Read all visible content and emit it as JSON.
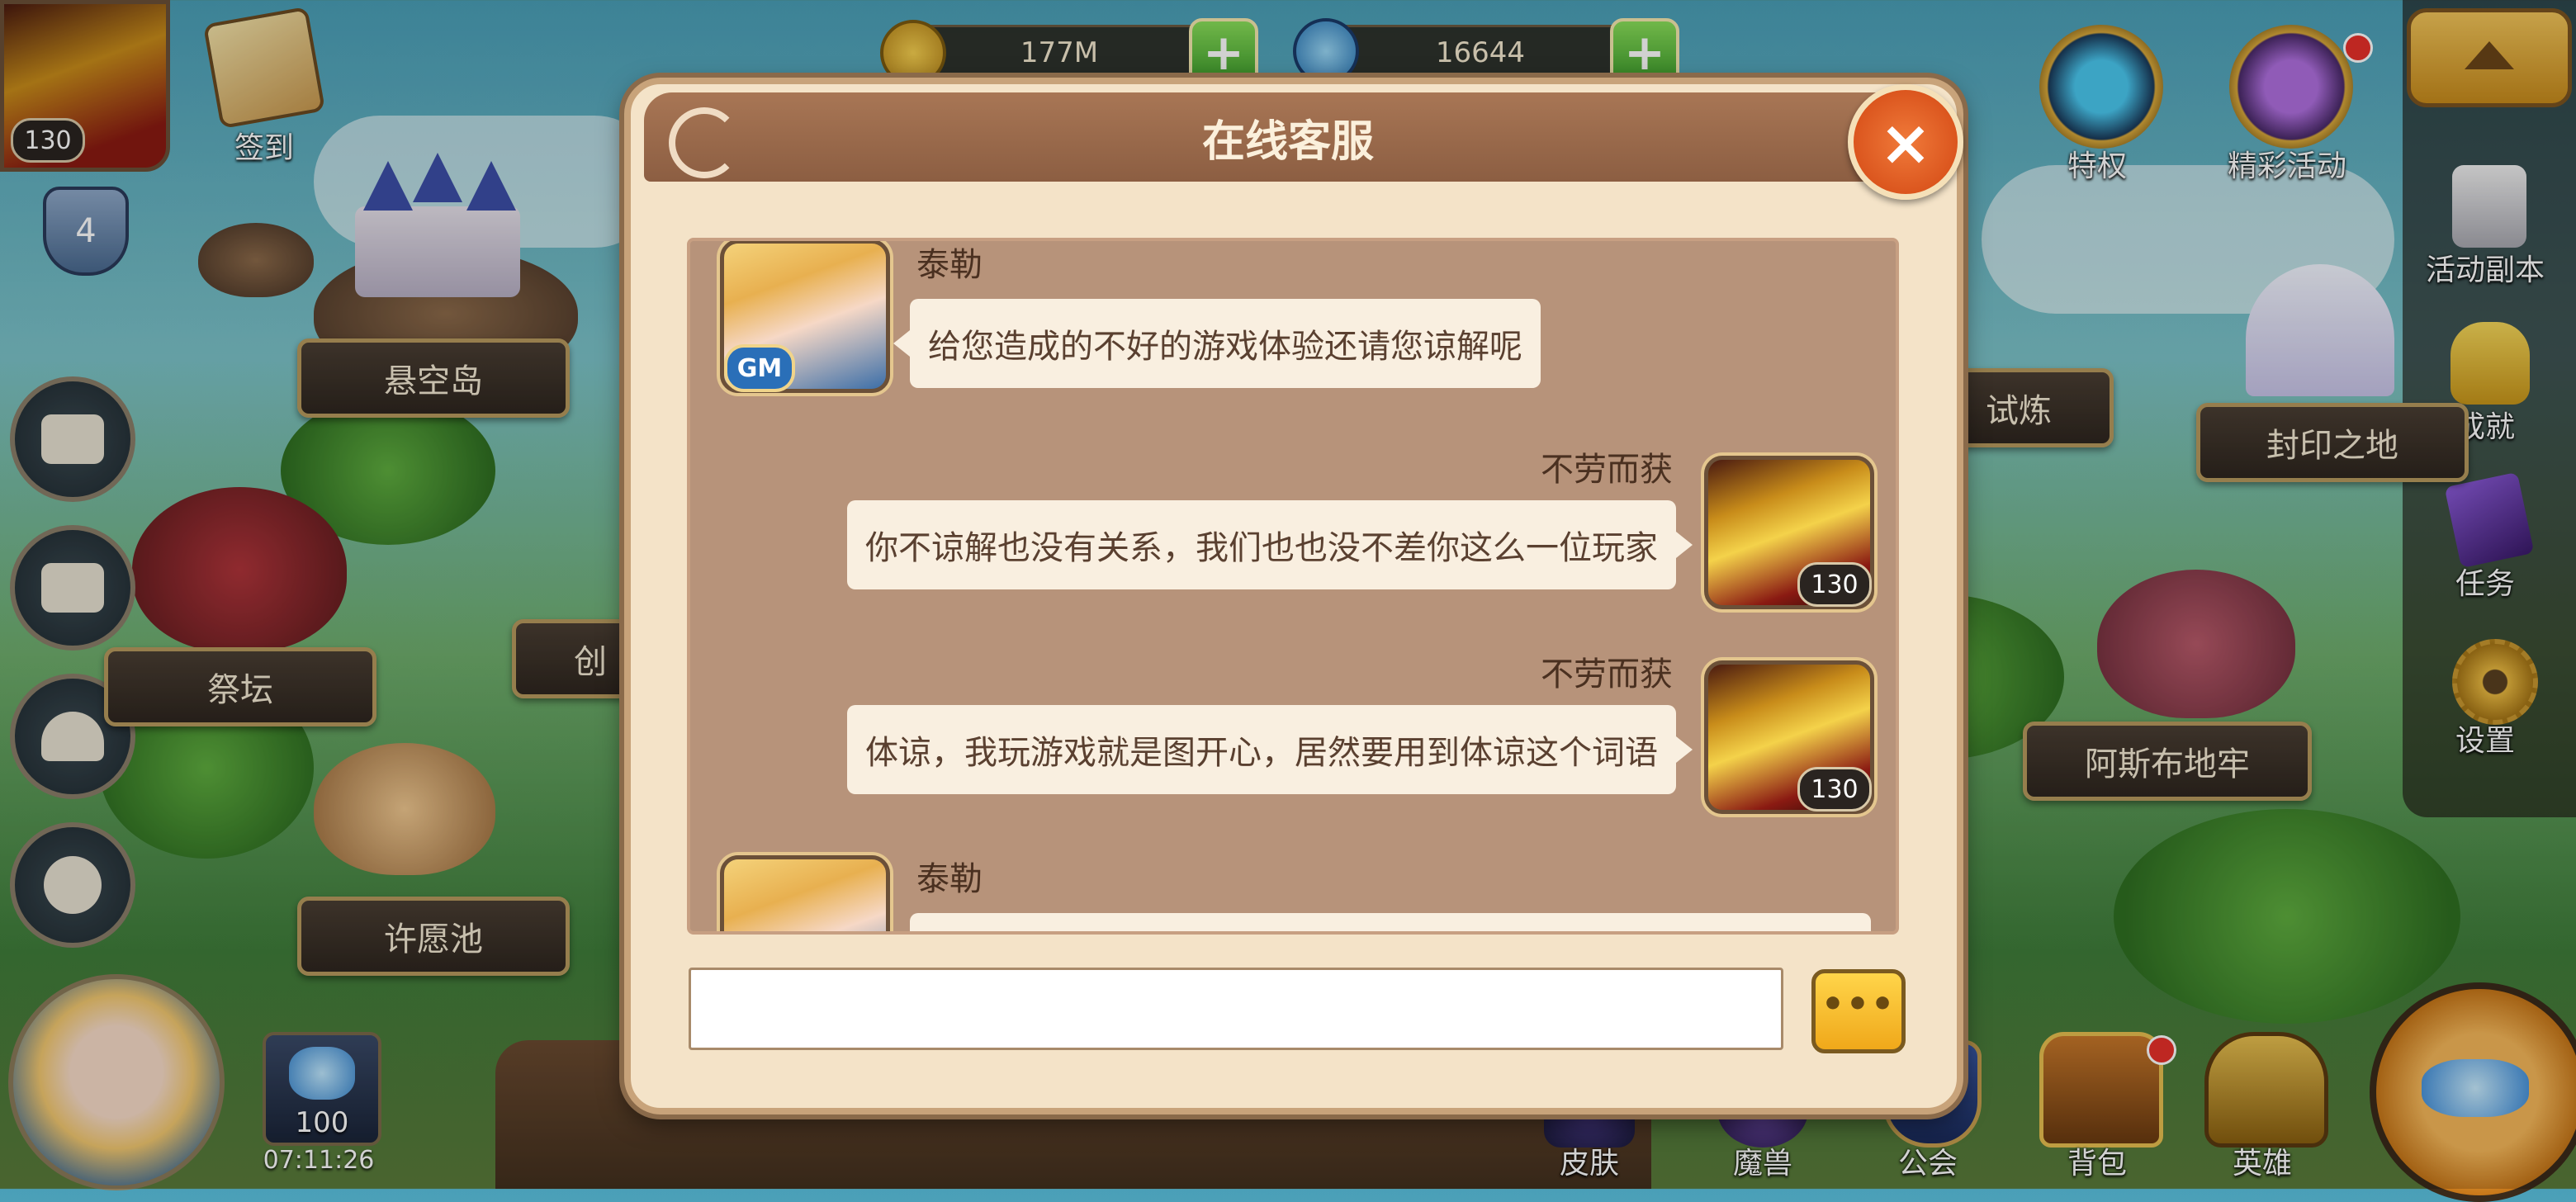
{
  "player": {
    "level": "130",
    "vip": "4"
  },
  "top_left": {
    "signin_label": "签到"
  },
  "resources": {
    "gold": "177M",
    "gems": "16644"
  },
  "top_right": {
    "privilege_label": "特权",
    "events_label": "精彩活动"
  },
  "right_panel": {
    "items": [
      "活动副本",
      "成就",
      "任务",
      "设置"
    ]
  },
  "locations": {
    "floating_island": "悬空岛",
    "altar": "祭坛",
    "wishing_pool": "许愿池",
    "trial": "试炼",
    "sealed_land": "封印之地",
    "asbu_dungeon": "阿斯布地牢",
    "create_partial": "创"
  },
  "bottom_bar": {
    "hero_count": "100",
    "clock": "07:11:26",
    "items": [
      "皮肤",
      "魔兽",
      "公会",
      "背包",
      "英雄"
    ]
  },
  "modal": {
    "title": "在线客服",
    "close_icon": "×",
    "messages": [
      {
        "side": "left",
        "sender": "泰勒",
        "text": "给您造成的不好的游戏体验还请您谅解呢",
        "badge": "GM"
      },
      {
        "side": "right",
        "sender": "不劳而获",
        "text": "你不谅解也没有关系，我们也也没不差你这么一位玩家",
        "level": "130"
      },
      {
        "side": "right",
        "sender": "不劳而获",
        "text": "体谅，我玩游戏就是图开心，居然要用到体谅这个词语",
        "level": "130"
      },
      {
        "side": "left",
        "sender": "泰勒",
        "text": "",
        "badge": ""
      }
    ],
    "input_value": "",
    "send_icon": "•••"
  },
  "colors": {
    "header": "#8c5e42",
    "panel": "#f4e3c8",
    "chat_bg": "#b7937a",
    "close": "#d24612"
  }
}
